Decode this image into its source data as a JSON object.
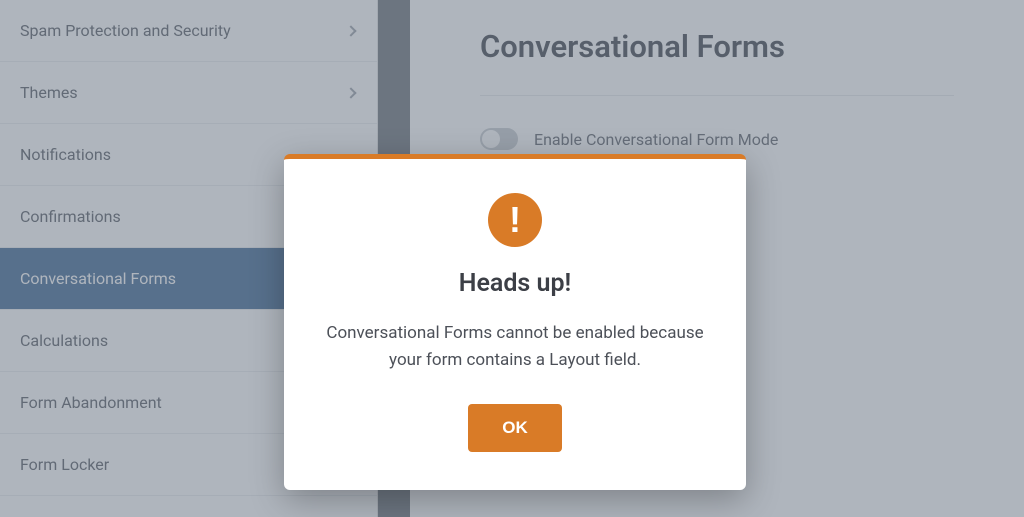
{
  "sidebar": {
    "items": [
      {
        "label": "Spam Protection and Security",
        "hasChevron": true
      },
      {
        "label": "Themes",
        "hasChevron": true
      },
      {
        "label": "Notifications"
      },
      {
        "label": "Confirmations"
      },
      {
        "label": "Conversational Forms",
        "active": true
      },
      {
        "label": "Calculations"
      },
      {
        "label": "Form Abandonment"
      },
      {
        "label": "Form Locker"
      }
    ]
  },
  "main": {
    "title": "Conversational Forms",
    "toggleLabel": "Enable Conversational Form Mode"
  },
  "modal": {
    "title": "Heads up!",
    "message": "Conversational Forms cannot be enabled because your form contains a Layout field.",
    "okLabel": "OK"
  }
}
